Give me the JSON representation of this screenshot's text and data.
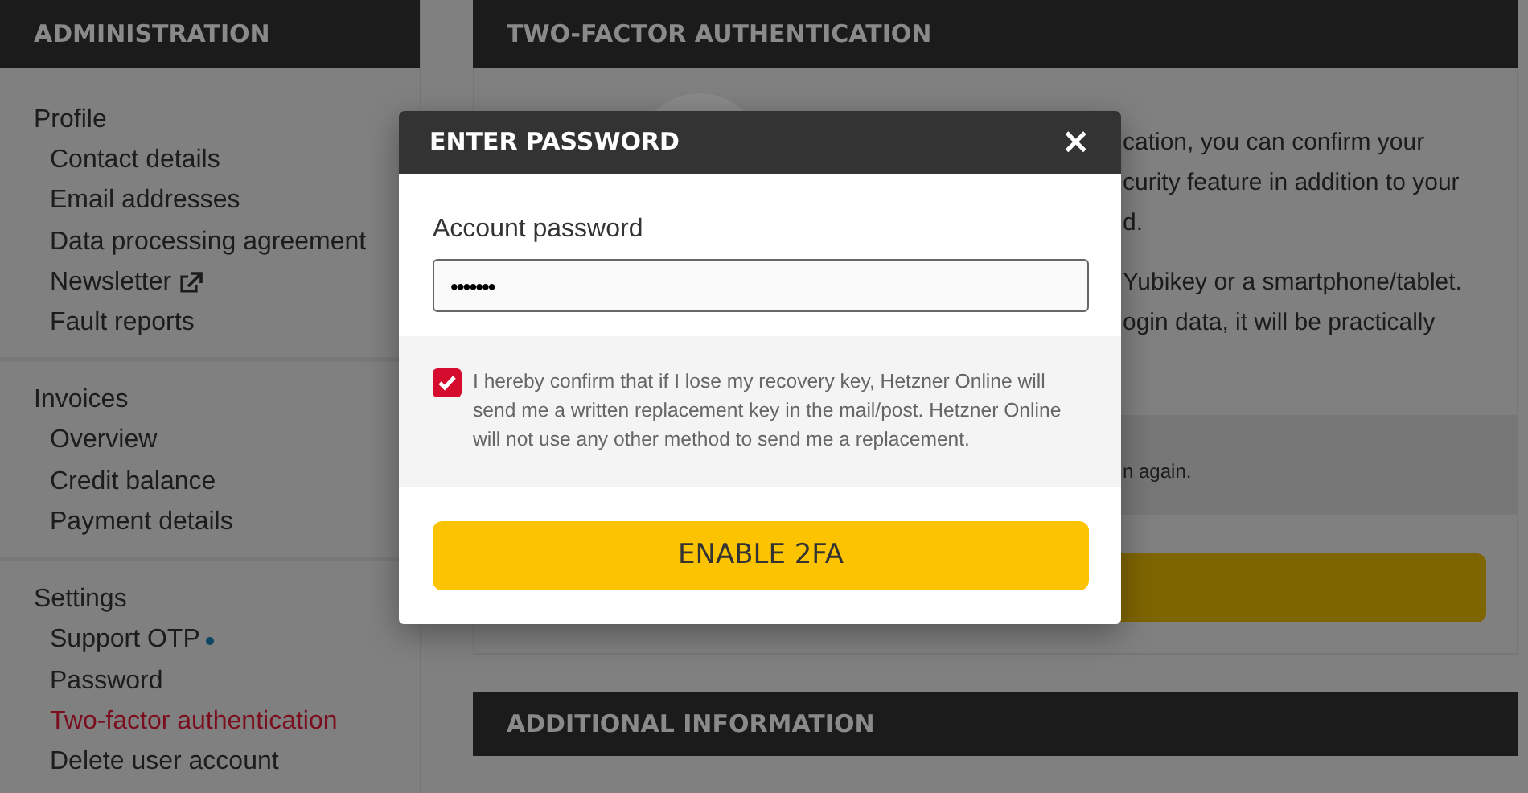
{
  "sidebar": {
    "title": "ADMINISTRATION",
    "sections": [
      {
        "title": "Profile",
        "items": [
          {
            "label": "Contact details",
            "kind": "link",
            "selected": false
          },
          {
            "label": "Email addresses",
            "kind": "link",
            "selected": false
          },
          {
            "label": "Data processing agreement",
            "kind": "link",
            "selected": false
          },
          {
            "label": "Newsletter",
            "kind": "external",
            "selected": false
          },
          {
            "label": "Fault reports",
            "kind": "link",
            "selected": false
          }
        ]
      },
      {
        "title": "Invoices",
        "items": [
          {
            "label": "Overview",
            "kind": "link",
            "selected": false
          },
          {
            "label": "Credit balance",
            "kind": "link",
            "selected": false
          },
          {
            "label": "Payment details",
            "kind": "link",
            "selected": false
          }
        ]
      },
      {
        "title": "Settings",
        "items": [
          {
            "label": "Support OTP",
            "kind": "dot",
            "selected": false
          },
          {
            "label": "Password",
            "kind": "link",
            "selected": false
          },
          {
            "label": "Two-factor authentication",
            "kind": "link",
            "selected": true
          },
          {
            "label": "Delete user account",
            "kind": "link",
            "selected": false
          }
        ]
      }
    ]
  },
  "main": {
    "title": "TWO-FACTOR AUTHENTICATION",
    "paragraphs": [
      [
        "cation, you can confirm your",
        "curity feature in addition to your",
        "d."
      ],
      [
        "Yubikey or a smartphone/tablet.",
        "ogin data, it will be practically"
      ]
    ],
    "notice": "n again.",
    "additional_title": "ADDITIONAL INFORMATION"
  },
  "modal": {
    "title": "ENTER PASSWORD",
    "close": "×",
    "label": "Account password",
    "value": "•••••••",
    "confirm_checked": true,
    "confirm_text": "I hereby confirm that if I lose my recovery key, Hetzner Online will send me a written replacement key in the mail/post. Hetzner Online will not use any other method to send me a replacement.",
    "button": "ENABLE 2FA"
  }
}
